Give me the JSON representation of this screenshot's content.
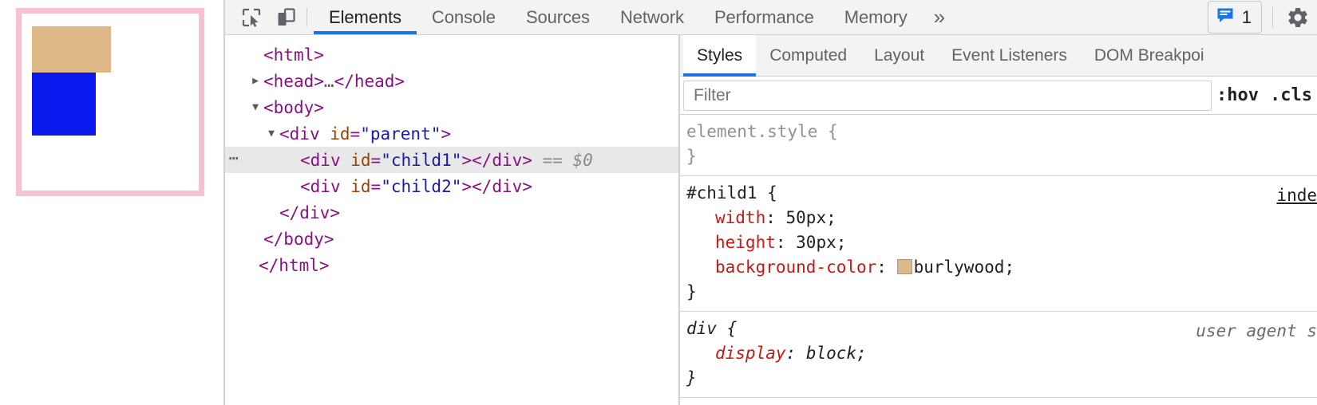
{
  "viewport": {
    "parent_border_color": "#f5c2ce",
    "child1_color": "#deb887",
    "child2_color": "#0b18ee"
  },
  "toolbar": {
    "inspect_icon": "inspect-element-icon",
    "device_icon": "device-toolbar-icon",
    "tabs": [
      {
        "label": "Elements",
        "active": true
      },
      {
        "label": "Console",
        "active": false
      },
      {
        "label": "Sources",
        "active": false
      },
      {
        "label": "Network",
        "active": false
      },
      {
        "label": "Performance",
        "active": false
      },
      {
        "label": "Memory",
        "active": false
      }
    ],
    "more_tabs_label": "»",
    "message_count": "1",
    "message_icon": "message-bubble-icon",
    "settings_icon": "gear-icon",
    "accent_color": "#1a73e8"
  },
  "dom_tree": {
    "rows": [
      {
        "indent": 0,
        "twisty": "",
        "gutter": "",
        "selected": false,
        "text": "<html>"
      },
      {
        "indent": 1,
        "twisty": "▶",
        "gutter": "",
        "selected": false,
        "text": "<head>…</head>"
      },
      {
        "indent": 1,
        "twisty": "▼",
        "gutter": "",
        "selected": false,
        "text": "<body>"
      },
      {
        "indent": 2,
        "twisty": "▼",
        "gutter": "",
        "selected": false,
        "text": "<div id=\"parent\">"
      },
      {
        "indent": 3,
        "twisty": "",
        "gutter": "⋯",
        "selected": true,
        "text": "<div id=\"child1\"></div> == $0"
      },
      {
        "indent": 3,
        "twisty": "",
        "gutter": "",
        "selected": false,
        "text": "<div id=\"child2\"></div>"
      },
      {
        "indent": 2,
        "twisty": "",
        "gutter": "",
        "selected": false,
        "text": "</div>"
      },
      {
        "indent": 1,
        "twisty": "",
        "gutter": "",
        "selected": false,
        "text": "</body>"
      },
      {
        "indent": 0,
        "twisty": "",
        "gutter": "",
        "selected": false,
        "text": "</html>"
      }
    ],
    "selected_suffix": "== $0",
    "parent_id": "parent",
    "child1_id": "child1",
    "child2_id": "child2"
  },
  "styles_panel": {
    "tabs": [
      {
        "label": "Styles",
        "active": true
      },
      {
        "label": "Computed",
        "active": false
      },
      {
        "label": "Layout",
        "active": false
      },
      {
        "label": "Event Listeners",
        "active": false
      },
      {
        "label": "DOM Breakpoi",
        "active": false
      }
    ],
    "filter_placeholder": "Filter",
    "filter_value": "",
    "hov_label": ":hov",
    "cls_label": ".cls",
    "rules": [
      {
        "selector": "element.style {",
        "close": "}",
        "origin": "",
        "declarations": []
      },
      {
        "selector": "#child1 {",
        "close": "}",
        "origin": "inde",
        "declarations": [
          {
            "prop": "width",
            "value": "50px",
            "swatch": ""
          },
          {
            "prop": "height",
            "value": "30px",
            "swatch": ""
          },
          {
            "prop": "background-color",
            "value": "burlywood",
            "swatch": "#deb887"
          }
        ]
      },
      {
        "selector": "div {",
        "close": "}",
        "origin": "user agent s",
        "declarations": [
          {
            "prop": "display",
            "value": "block",
            "swatch": ""
          }
        ]
      }
    ]
  }
}
